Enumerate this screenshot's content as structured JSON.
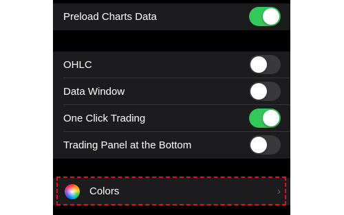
{
  "settings": {
    "preload_group": [
      {
        "label": "Preload Charts Data",
        "toggle_on": true
      }
    ],
    "display_group": [
      {
        "label": "OHLC",
        "toggle_on": false
      },
      {
        "label": "Data Window",
        "toggle_on": false
      },
      {
        "label": "One Click Trading",
        "toggle_on": true
      },
      {
        "label": "Trading Panel at the Bottom",
        "toggle_on": false
      }
    ],
    "colors_row": {
      "label": "Colors",
      "icon": "color-wheel-icon",
      "chevron": "›"
    }
  },
  "colors": {
    "background": "#000000",
    "group_background": "#1c1c1e",
    "toggle_on": "#34c759",
    "toggle_off": "#39393d",
    "highlight_border": "#e0141e"
  }
}
